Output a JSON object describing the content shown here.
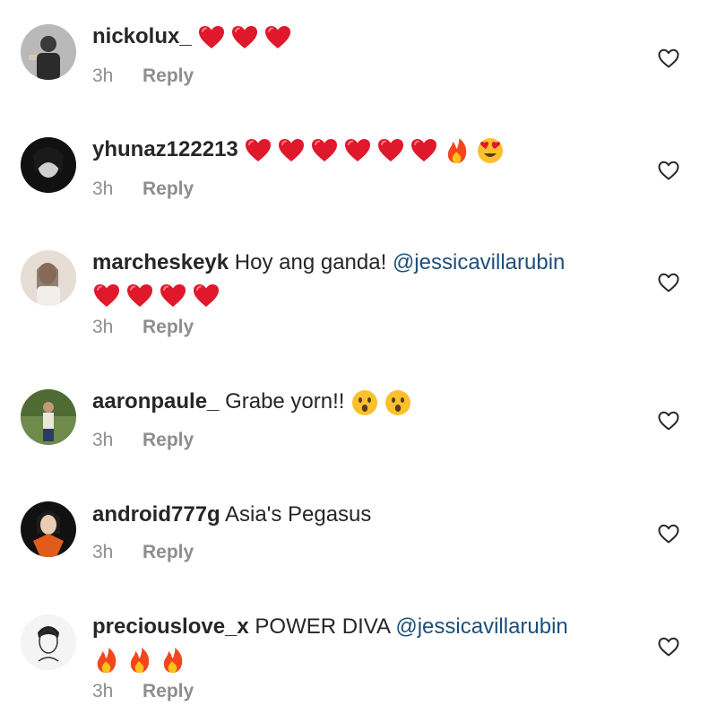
{
  "comments": [
    {
      "username": "nickolux_",
      "text": "",
      "mention": "",
      "emojis": [
        "heart",
        "heart",
        "heart"
      ],
      "time": "3h",
      "reply": "Reply"
    },
    {
      "username": "yhunaz122213",
      "text": "",
      "mention": "",
      "emojis": [
        "heart",
        "heart",
        "heart",
        "heart",
        "heart",
        "heart",
        "fire",
        "heart-eyes"
      ],
      "time": "3h",
      "reply": "Reply"
    },
    {
      "username": "marcheskeyk",
      "text": "Hoy ang ganda!",
      "mention": "@jessicavillarubin",
      "emojis": [
        "heart",
        "heart",
        "heart",
        "heart"
      ],
      "time": "3h",
      "reply": "Reply"
    },
    {
      "username": "aaronpaule_",
      "text": "Grabe yorn!!",
      "mention": "",
      "emojis": [
        "surprised",
        "surprised"
      ],
      "time": "3h",
      "reply": "Reply"
    },
    {
      "username": "android777g",
      "text": "Asia's Pegasus",
      "mention": "",
      "emojis": [],
      "time": "3h",
      "reply": "Reply"
    },
    {
      "username": "preciouslove_x",
      "text": "POWER DIVA",
      "mention": "@jessicavillarubin",
      "emojis": [
        "fire",
        "fire",
        "fire"
      ],
      "time": "3h",
      "reply": "Reply"
    }
  ],
  "colors": {
    "username": "#262626",
    "mention": "#1b4f7c",
    "meta": "#8e8e8e",
    "heart": "#e0182b"
  }
}
